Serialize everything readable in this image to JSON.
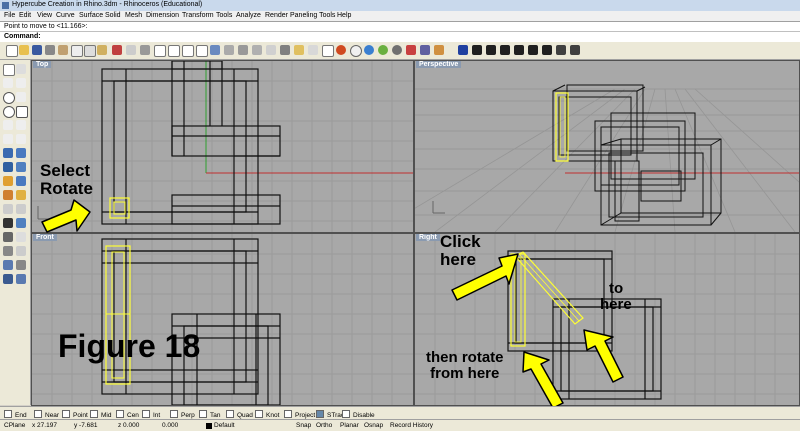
{
  "window": {
    "title": "Hypercube Creation in Rhino.3dm - Rhinoceros (Educational)"
  },
  "menu": [
    "File",
    "Edit",
    "View",
    "Curve",
    "Surface",
    "Solid",
    "Mesh",
    "Dimension",
    "Transform",
    "Tools",
    "Analyze",
    "Render",
    "Paneling Tools",
    "Help"
  ],
  "command": {
    "history": "Point to move to <11.166>:",
    "prompt": "Command:"
  },
  "viewports": {
    "top": "Top",
    "perspective": "Perspective",
    "front": "Front",
    "right": "Right"
  },
  "annotations": {
    "select_rotate_1": "Select",
    "select_rotate_2": "Rotate",
    "figure": "Figure 18",
    "click_1": "Click",
    "click_2": "here",
    "to_1": "to",
    "to_2": "here",
    "then_1": "then rotate",
    "then_2": "from here"
  },
  "osnaps": [
    {
      "label": "End",
      "checked": false
    },
    {
      "label": "Near",
      "checked": false
    },
    {
      "label": "Point",
      "checked": false
    },
    {
      "label": "Mid",
      "checked": false
    },
    {
      "label": "Cen",
      "checked": false
    },
    {
      "label": "Int",
      "checked": false
    },
    {
      "label": "Perp",
      "checked": false
    },
    {
      "label": "Tan",
      "checked": false
    },
    {
      "label": "Quad",
      "checked": false
    },
    {
      "label": "Knot",
      "checked": false
    },
    {
      "label": "Project",
      "checked": false
    },
    {
      "label": "STrack",
      "checked": true
    },
    {
      "label": "Disable",
      "checked": false
    }
  ],
  "status": {
    "cplane": "CPlane",
    "x": "x 27.197",
    "y": "y -7.681",
    "z": "z 0.000",
    "w": "0.000",
    "layer": "Default",
    "snap": "Snap",
    "ortho": "Ortho",
    "planar": "Planar",
    "osnap": "Osnap",
    "record": "Record History"
  },
  "colors": {
    "viewport_bg": "#a8a8a8",
    "arrow": "#ffff00",
    "selected": "#ffff33",
    "x_axis": "#c03030",
    "y_axis": "#30a030"
  }
}
